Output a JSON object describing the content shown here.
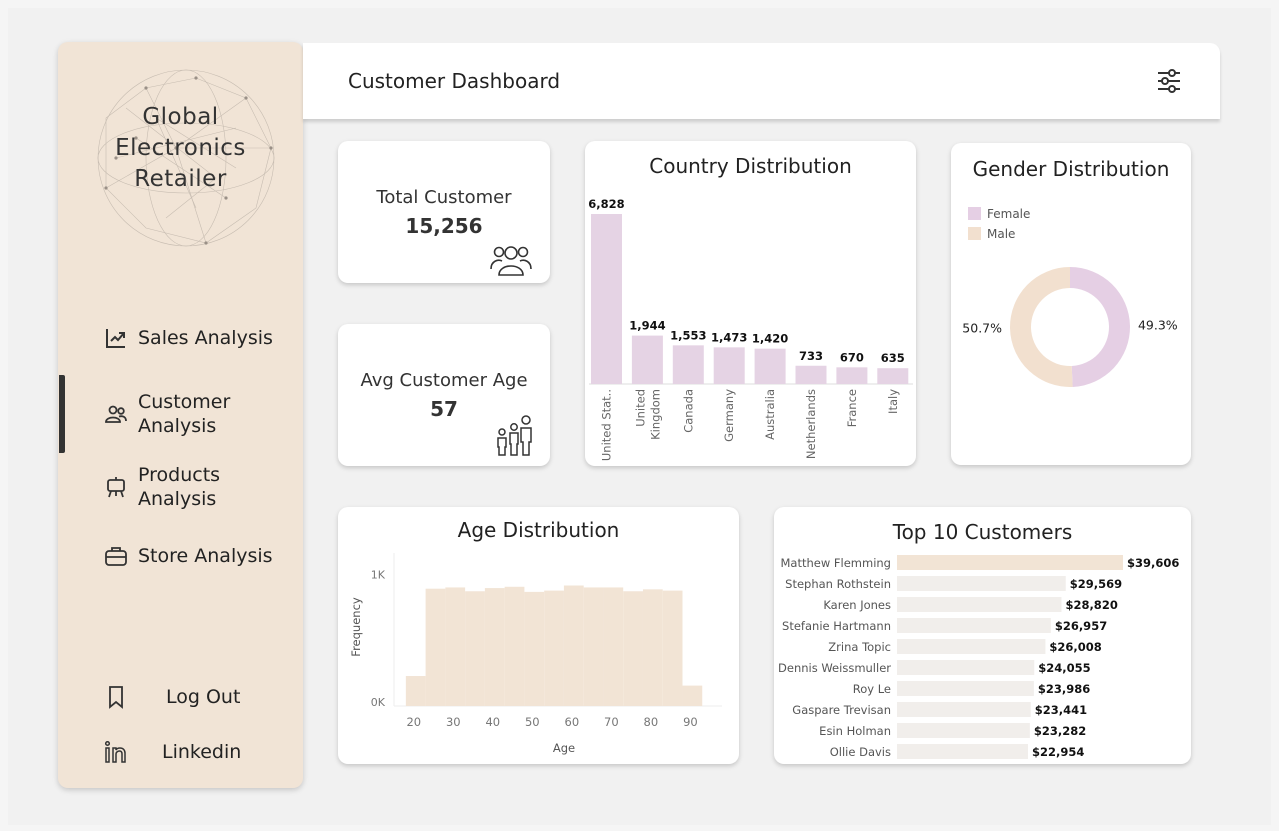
{
  "sidebar": {
    "brand_line1": "Global",
    "brand_line2": "Electronics",
    "brand_line3": "Retailer",
    "nav": [
      {
        "line1": "Sales Analysis",
        "line2": "",
        "icon": "trend-chart-icon"
      },
      {
        "line1": "Customer",
        "line2": "Analysis",
        "icon": "users-icon"
      },
      {
        "line1": "Products",
        "line2": "Analysis",
        "icon": "easel-icon"
      },
      {
        "line1": "Store Analysis",
        "line2": "",
        "icon": "briefcase-icon"
      }
    ],
    "logout": "Log Out",
    "linkedin": "Linkedin"
  },
  "header": {
    "title": "Customer Dashboard"
  },
  "kpis": {
    "total_label": "Total Customer",
    "total_value": "15,256",
    "age_label": "Avg Customer Age",
    "age_value": "57"
  },
  "country": {
    "title": "Country Distribution",
    "chart_data": {
      "type": "bar",
      "categories": [
        "United Stat..",
        "United Kingdom",
        "Canada",
        "Germany",
        "Australia",
        "Netherlands",
        "France",
        "Italy"
      ],
      "values": [
        6828,
        1944,
        1553,
        1473,
        1420,
        733,
        670,
        635
      ],
      "labels": [
        "6,828",
        "1,944",
        "1,553",
        "1,473",
        "1,420",
        "733",
        "670",
        "635"
      ],
      "color": "#e5d3e4"
    }
  },
  "gender": {
    "title": "Gender Distribution",
    "chart_data": {
      "type": "pie",
      "categories": [
        "Female",
        "Male"
      ],
      "values": [
        49.3,
        50.7
      ],
      "labels": [
        "49.3%",
        "50.7%"
      ],
      "colors": [
        "#e5cfe4",
        "#f2e0cf"
      ]
    }
  },
  "age": {
    "title": "Age Distribution",
    "chart_data": {
      "type": "bar",
      "xlabel": "Age",
      "ylabel": "Frequency",
      "xticks": [
        "20",
        "30",
        "40",
        "50",
        "60",
        "70",
        "80",
        "90"
      ],
      "yticks": [
        "0K",
        "1K"
      ],
      "bins_start": [
        18,
        23,
        28,
        33,
        38,
        43,
        48,
        53,
        58,
        63,
        68,
        73,
        78,
        83,
        88,
        93
      ],
      "values": [
        235,
        920,
        930,
        900,
        925,
        935,
        895,
        905,
        945,
        930,
        930,
        900,
        915,
        905,
        160,
        0
      ],
      "color": "#f2e4d5"
    }
  },
  "top10": {
    "title": "Top 10 Customers",
    "chart_data": {
      "type": "bar",
      "categories": [
        "Matthew Flemming",
        "Stephan Rothstein",
        "Karen Jones",
        "Stefanie Hartmann",
        "Zrina Topic",
        "Dennis Weissmuller",
        "Roy Le",
        "Gaspare Trevisan",
        "Esin Holman",
        "Ollie Davis"
      ],
      "values": [
        39606,
        29569,
        28820,
        26957,
        26008,
        24055,
        23986,
        23441,
        23282,
        22954
      ],
      "labels": [
        "$39,606",
        "$29,569",
        "$28,820",
        "$26,957",
        "$26,008",
        "$24,055",
        "$23,986",
        "$23,441",
        "$23,282",
        "$22,954"
      ],
      "highlight_color": "#f2e4d5",
      "color": "#f1eeeb"
    }
  }
}
